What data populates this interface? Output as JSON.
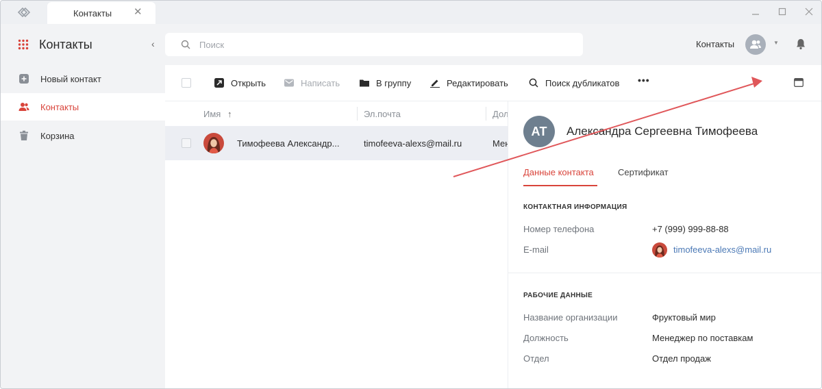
{
  "tab": {
    "title": "Контакты",
    "close": "✕"
  },
  "header": {
    "title": "Контакты",
    "search_placeholder": "Поиск",
    "account_label": "Контакты"
  },
  "sidebar": {
    "items": [
      {
        "label": "Новый контакт",
        "icon": "plus-square-icon",
        "active": false
      },
      {
        "label": "Контакты",
        "icon": "users-icon",
        "active": true
      },
      {
        "label": "Корзина",
        "icon": "trash-icon",
        "active": false
      }
    ]
  },
  "toolbar": {
    "open": "Открыть",
    "write": "Написать",
    "to_group": "В группу",
    "edit": "Редактировать",
    "find_duplicates": "Поиск дубликатов",
    "more": "•••"
  },
  "table": {
    "columns": [
      "Имя",
      "Эл.почта",
      "Дол"
    ],
    "sort_indicator": "↑",
    "rows": [
      {
        "name": "Тимофеева Александр...",
        "email": "timofeeva-alexs@mail.ru",
        "position": "Мен"
      }
    ]
  },
  "detail": {
    "initials": "АТ",
    "full_name": "Александра Сергеевна Тимофеева",
    "tabs": [
      "Данные контакта",
      "Сертификат"
    ],
    "contact_section": "КОНТАКТНАЯ ИНФОРМАЦИЯ",
    "phone_label": "Номер телефона",
    "phone_value": "+7 (999) 999-88-88",
    "email_label": "E-mail",
    "email_value": "timofeeva-alexs@mail.ru",
    "work_section": "РАБОЧИЕ ДАННЫЕ",
    "org_label": "Название организации",
    "org_value": "Фруктовый мир",
    "position_label": "Должность",
    "position_value": "Менеджер по поставкам",
    "dept_label": "Отдел",
    "dept_value": "Отдел продаж"
  },
  "colors": {
    "accent": "#d9443b",
    "link": "#4a78b5",
    "annotation_arrow": "#e0575a"
  }
}
